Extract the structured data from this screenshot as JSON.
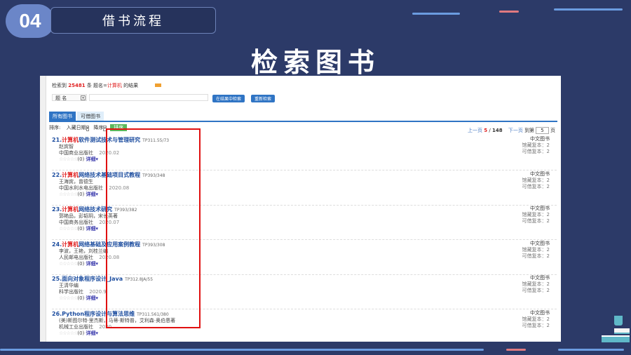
{
  "slide": {
    "number": "04",
    "section": "借书流程",
    "heading": "检索图书"
  },
  "search": {
    "summary_prefix": "检索到",
    "count": "25481",
    "summary_mid": "条 题名=",
    "keyword": "计算机",
    "summary_suffix": "的结果",
    "field": "题 名",
    "input_value": "",
    "search_within": "在结果中检索",
    "new_search": "重新检索",
    "tabs": [
      "所有图书",
      "可借图书"
    ],
    "sort_label": "排序:",
    "sort_field": "入藏日期",
    "sort_order": "降序",
    "sort_button": "排序",
    "pager": {
      "prev": "上一页",
      "current": "5",
      "total": "148",
      "next": "下一页",
      "goto_label": "到第",
      "goto_value": "5",
      "goto_suffix": "页"
    }
  },
  "records": [
    {
      "no": "21.",
      "hl": "计算机",
      "title": "软件测试技术与管理研究",
      "callno": "TP311.55/73",
      "author": "赵宾智",
      "publisher": "中国商业出版社",
      "year": "2020.02",
      "type": "中文图书",
      "holdings": "馆藏复本：2",
      "available": "可借复本：2",
      "stars": "☆☆☆☆☆",
      "rating": "(0)",
      "detail": "详细▾"
    },
    {
      "no": "22.",
      "hl": "计算机",
      "title": "网络技术基础项目式教程",
      "callno": "TP393/348",
      "author": "王海宾，曾德生",
      "publisher": "中国水利水电出版社",
      "year": "2020.08",
      "type": "中文图书",
      "holdings": "馆藏复本：2",
      "available": "可借复本：2",
      "stars": "☆☆☆☆☆",
      "rating": "(0)",
      "detail": "详细▾"
    },
    {
      "no": "23.",
      "hl": "计算机",
      "title": "网络技术研究",
      "callno": "TP393/382",
      "author": "郭艳品，彭韬玥，宋长英著",
      "publisher": "中国商务出版社",
      "year": "2020.07",
      "type": "中文图书",
      "holdings": "馆藏复本：2",
      "available": "可借复本：2",
      "stars": "☆☆☆☆☆",
      "rating": "(0)",
      "detail": "详细▾"
    },
    {
      "no": "24.",
      "hl": "计算机",
      "title": "网络基础及应用案例教程",
      "callno": "TP393/308",
      "author": "李波，王艳，刘桂兰编",
      "publisher": "人民邮电出版社",
      "year": "2020.08",
      "type": "中文图书",
      "holdings": "馆藏复本：2",
      "available": "可借复本：2",
      "stars": "☆☆☆☆☆",
      "rating": "(0)",
      "detail": "详细▾"
    },
    {
      "no": "25.",
      "hl": "",
      "title": "面向对象程序设计_Java",
      "callno": "TP312.8JA/55",
      "author": "王清华编",
      "publisher": "科学出版社",
      "year": "2020.9",
      "type": "中文图书",
      "holdings": "馆藏复本：2",
      "available": "可借复本：2",
      "stars": "☆☆☆☆☆",
      "rating": "(0)",
      "detail": "详细▾"
    },
    {
      "no": "26.",
      "hl": "",
      "title": "Python程序设计与算法思维",
      "callno": "TP311.561/380",
      "author": "(美)斯图尔特·里杰斯，马蒂·斯特普，艾利森·奥伯恩著",
      "publisher": "机械工业出版社",
      "year": "2020",
      "type": "中文图书",
      "holdings": "馆藏复本：2",
      "available": "可借复本：2",
      "stars": "☆☆☆☆☆",
      "rating": "(0)",
      "detail": "详细▾"
    }
  ],
  "colors": {
    "background": "#2c3a68",
    "accent": "#6b86c8",
    "highlight": "#e01010"
  }
}
